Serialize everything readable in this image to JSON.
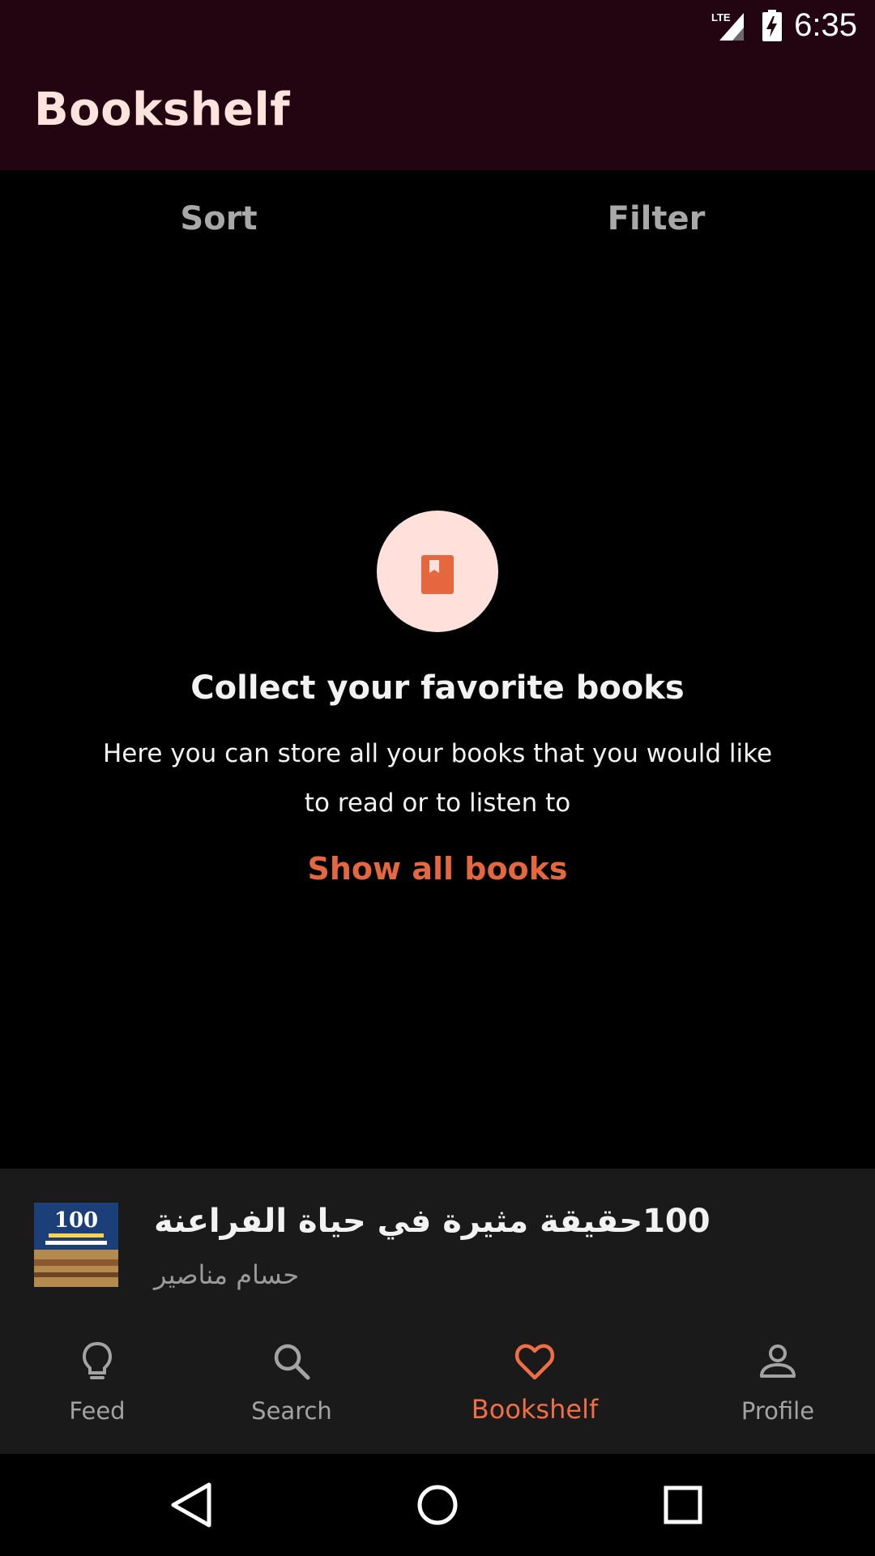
{
  "status_bar": {
    "time": "6:35",
    "network": "LTE"
  },
  "app_bar": {
    "title": "Bookshelf"
  },
  "toolbar": {
    "sort_label": "Sort",
    "filter_label": "Filter"
  },
  "empty_state": {
    "icon": "book-icon",
    "title": "Collect your favorite books",
    "description": "Here you can store all your books that you would like to read or to listen to",
    "action_label": "Show all books"
  },
  "mini_player": {
    "title": "100حقيقة مثيرة في حياة الفراعنة",
    "author": "حسام مناصير",
    "cover_text": "100"
  },
  "bottom_nav": {
    "items": [
      {
        "label": "Feed",
        "icon": "lightbulb-icon"
      },
      {
        "label": "Search",
        "icon": "search-icon"
      },
      {
        "label": "Bookshelf",
        "icon": "heart-icon",
        "active": true
      },
      {
        "label": "Profile",
        "icon": "person-icon"
      }
    ]
  },
  "colors": {
    "app_bar_bg": "#220510",
    "accent": "#e4673f",
    "empty_circle": "#ffe0da",
    "surface": "#1a1a1a"
  }
}
